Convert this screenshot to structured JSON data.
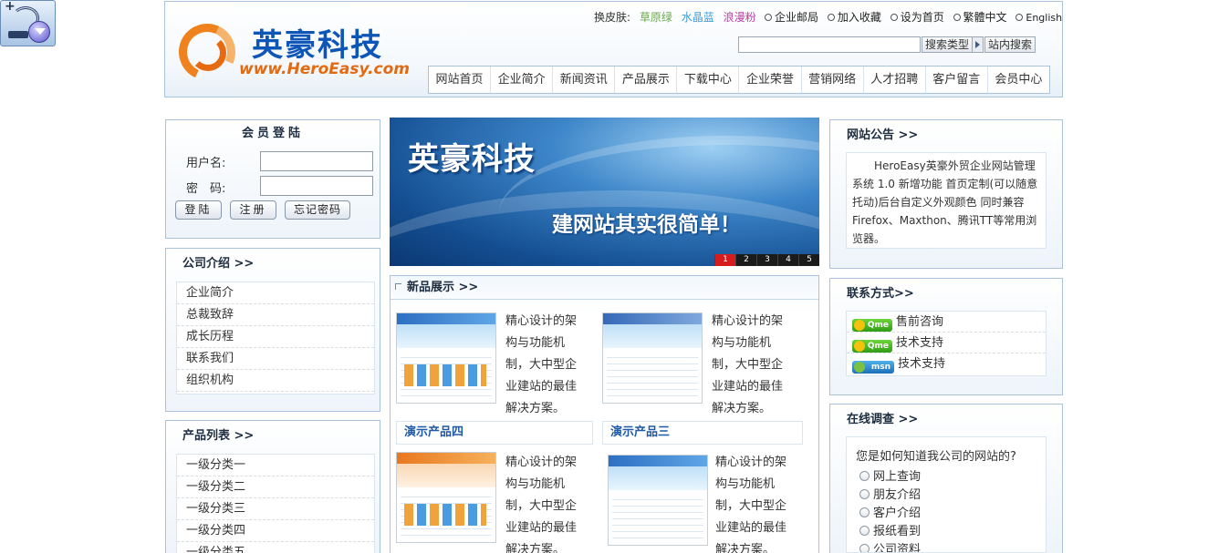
{
  "header": {
    "logo_cn": "英豪科技",
    "logo_en": "www.HeroEasy.com",
    "skin_label": "换皮肤:",
    "skins": [
      "草原绿",
      "水晶蓝",
      "浪漫粉"
    ],
    "top_links": [
      "企业邮局",
      "加入收藏",
      "设为首页",
      "繁體中文",
      "English"
    ],
    "search_placeholder": "",
    "search_type_label": "搜索类型",
    "search_button": "站内搜索",
    "nav": [
      "网站首页",
      "企业简介",
      "新闻资讯",
      "产品展示",
      "下载中心",
      "企业荣誉",
      "营销网络",
      "人才招聘",
      "客户留言",
      "会员中心"
    ]
  },
  "login": {
    "title": "会员登陆",
    "username_label": "用户名:",
    "password_label": "密　码:",
    "login_button": "登陆",
    "register_button": "注册",
    "forgot_button": "忘记密码"
  },
  "company": {
    "title": "公司介绍 >>",
    "items": [
      "企业简介",
      "总裁致辞",
      "成长历程",
      "联系我们",
      "组织机构"
    ]
  },
  "products_list": {
    "title": "产品列表 >>",
    "items": [
      "一级分类一",
      "一级分类二",
      "一级分类三",
      "一级分类四",
      "一级分类五"
    ]
  },
  "banner": {
    "title": "英豪科技",
    "slogan": "建网站其实很简单！",
    "pages": [
      "1",
      "2",
      "3",
      "4",
      "5"
    ],
    "active_page": "1"
  },
  "new_products": {
    "title": "新品展示 >>",
    "items": [
      {
        "desc": "精心设计的架构与功能机制，大中型企业建站的最佳解决方案。",
        "caption": "演示产品四"
      },
      {
        "desc": "精心设计的架构与功能机制，大中型企业建站的最佳解决方案。",
        "caption": "演示产品三"
      },
      {
        "desc": "精心设计的架构与功能机制，大中型企业建站的最佳解决方案。",
        "caption": ""
      },
      {
        "desc": "精心设计的架构与功能机制，大中型企业建站的最佳解决方案。",
        "caption": ""
      }
    ]
  },
  "notice": {
    "title": "网站公告 >>",
    "text": "HeroEasy英豪外贸企业网站管理系统 1.0 新增功能 首页定制(可以随意托动)后台自定义外观颜色 同时兼容Firefox、Maxthon、腾讯TT等常用浏览器。"
  },
  "contact": {
    "title": "联系方式>>",
    "items": [
      {
        "badge": "Qme",
        "label": "售前咨询"
      },
      {
        "badge": "Qme",
        "label": "技术支持"
      },
      {
        "badge": "msn",
        "label": "技术支持"
      }
    ]
  },
  "survey": {
    "title": "在线调查 >>",
    "question": "您是如何知道我公司的网站的?",
    "options": [
      "网上查询",
      "朋友介绍",
      "客户介绍",
      "报纸看到",
      "公司资料"
    ]
  }
}
